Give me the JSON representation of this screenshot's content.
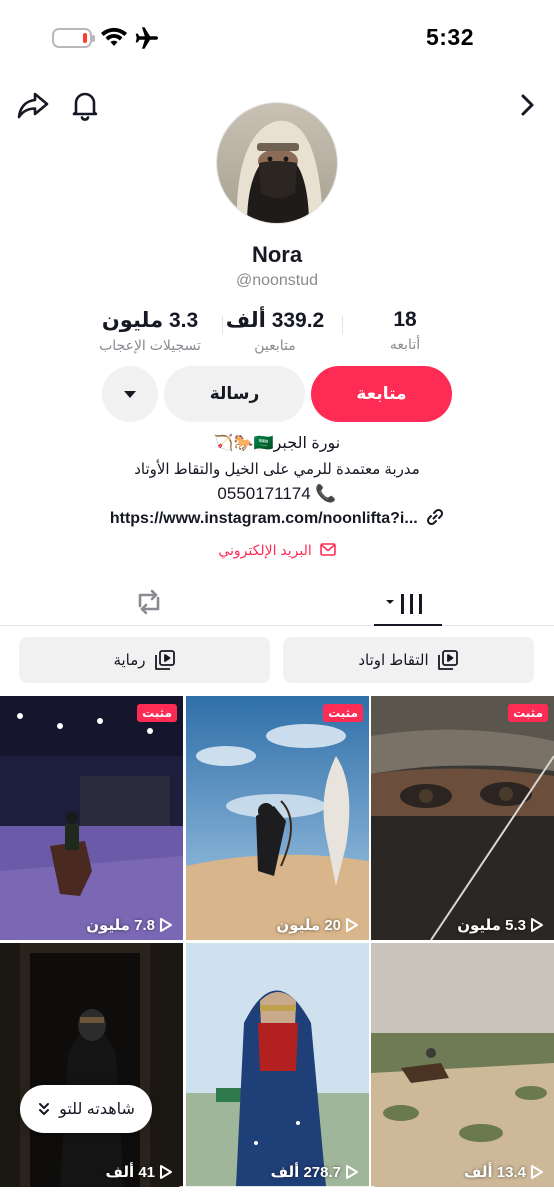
{
  "status_bar": {
    "time": "5:32",
    "battery_icon": "battery-icon",
    "wifi_icon": "wifi-icon",
    "plane_icon": "airplane-mode-icon"
  },
  "top_bar": {
    "share_icon": "share-icon",
    "bell_icon": "bell-icon",
    "forward_icon": "chevron-right-icon"
  },
  "profile": {
    "display_name": "Nora",
    "username": "@noonstud",
    "stats": [
      {
        "value": "3.3 مليون",
        "label": "تسجيلات الإعجاب"
      },
      {
        "value": "339.2 ألف",
        "label": "متابعين"
      },
      {
        "value": "18",
        "label": "أتابعه"
      }
    ],
    "follow_label": "متابعة",
    "message_label": "رسالة",
    "bio": {
      "name_line": "نورة الجبر🇸🇦🐎🏹",
      "desc_line": "مدربة معتمدة للرمي على الخيل والتقاط الأوتاد",
      "phone_line": "📞 0550171174",
      "link": "https://www.instagram.com/noonlifta?i...",
      "email_label": "البريد الإلكتروني"
    }
  },
  "tabs": [
    "videos-tab",
    "reposts-tab"
  ],
  "playlists": [
    {
      "label": "التقاط اوتاد"
    },
    {
      "label": "رماية"
    }
  ],
  "videos": [
    {
      "views": "5.3 مليون",
      "pinned": "مثبت"
    },
    {
      "views": "20 مليون",
      "pinned": "مثبت"
    },
    {
      "views": "7.8 مليون",
      "pinned": "مثبت"
    },
    {
      "views": "13.4 ألف"
    },
    {
      "views": "278.7 ألف"
    },
    {
      "views": "41 ألف"
    }
  ],
  "watched_chip": {
    "label": "شاهدته للتو"
  },
  "colors": {
    "accent": "#fe2c55",
    "secondary_bg": "#f1f1f2",
    "muted_text": "#8a8b91"
  }
}
